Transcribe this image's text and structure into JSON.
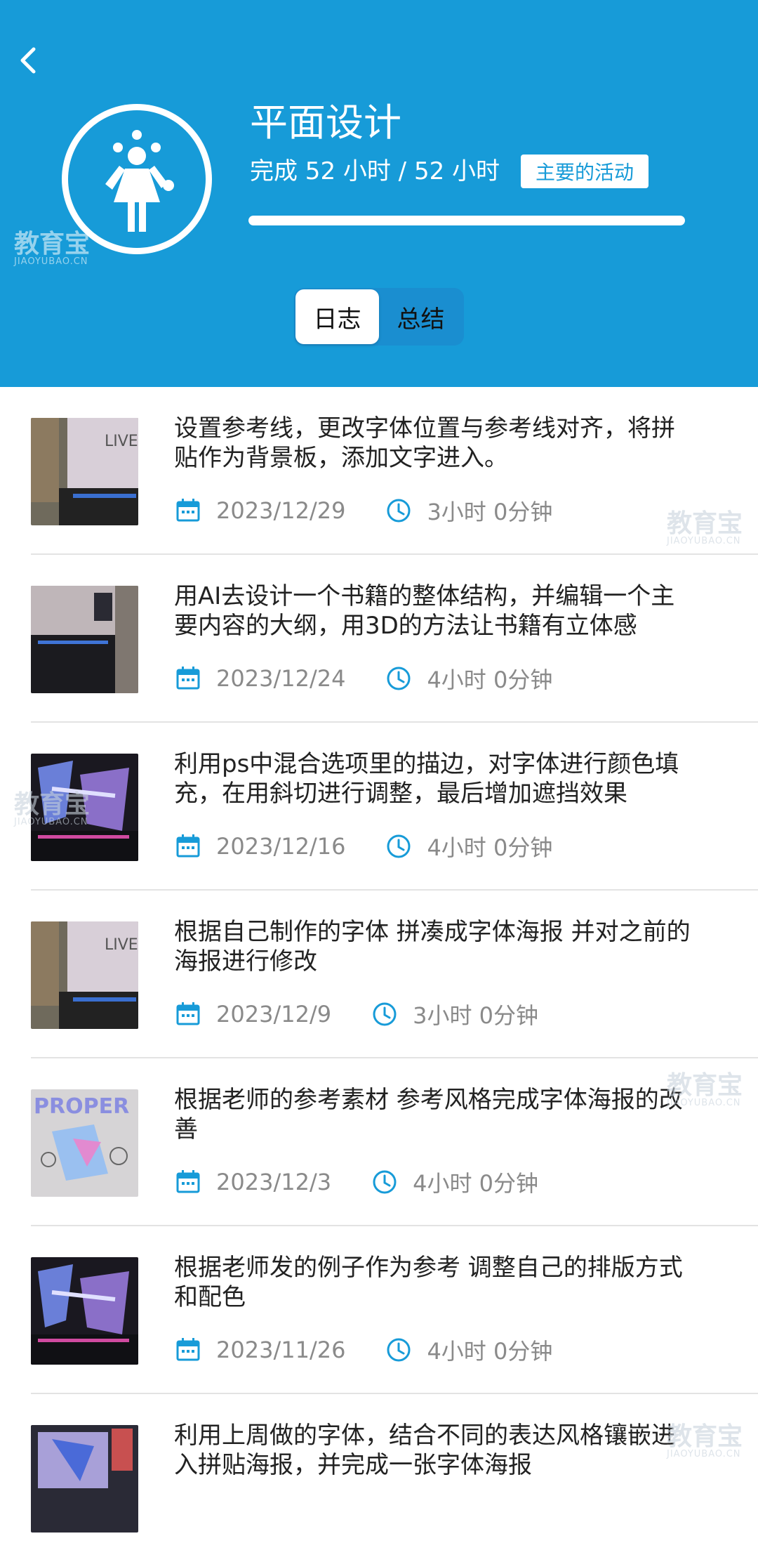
{
  "header": {
    "title": "平面设计",
    "progress_text": "完成 52 小时 / 52 小时",
    "badge": "主要的活动",
    "progress_fraction": 1.0
  },
  "tabs": [
    {
      "label": "日志",
      "active": true
    },
    {
      "label": "总结",
      "active": false
    }
  ],
  "entries": [
    {
      "text": "设置参考线，更改字体位置与参考线对齐，将拼贴作为背景板，添加文字进入。",
      "date": "2023/12/29",
      "duration": "3小时 0分钟"
    },
    {
      "text": "用AI去设计一个书籍的整体结构，并编辑一个主要内容的大纲，用3D的方法让书籍有立体感",
      "date": "2023/12/24",
      "duration": "4小时 0分钟"
    },
    {
      "text": "利用ps中混合选项里的描边，对字体进行颜色填充，在用斜切进行调整，最后增加遮挡效果",
      "date": "2023/12/16",
      "duration": "4小时 0分钟"
    },
    {
      "text": "根据自己制作的字体 拼凑成字体海报 并对之前的海报进行修改",
      "date": "2023/12/9",
      "duration": "3小时 0分钟"
    },
    {
      "text": "根据老师的参考素材 参考风格完成字体海报的改善",
      "date": "2023/12/3",
      "duration": "4小时 0分钟"
    },
    {
      "text": "根据老师发的例子作为参考 调整自己的排版方式和配色",
      "date": "2023/11/26",
      "duration": "4小时 0分钟"
    },
    {
      "text": "利用上周做的字体，结合不同的表达风格镶嵌进入拼贴海报，并完成一张字体海报",
      "date": "",
      "duration": ""
    }
  ],
  "watermark": {
    "brand": "教育宝",
    "url": "JIAOYUBAO.CN"
  },
  "colors": {
    "accent": "#179bd8",
    "text": "#222222",
    "meta": "#8a8a8a"
  },
  "icons": {
    "back": "chevron-left-icon",
    "avatar": "juggler-icon",
    "date": "calendar-icon",
    "time": "clock-icon"
  }
}
